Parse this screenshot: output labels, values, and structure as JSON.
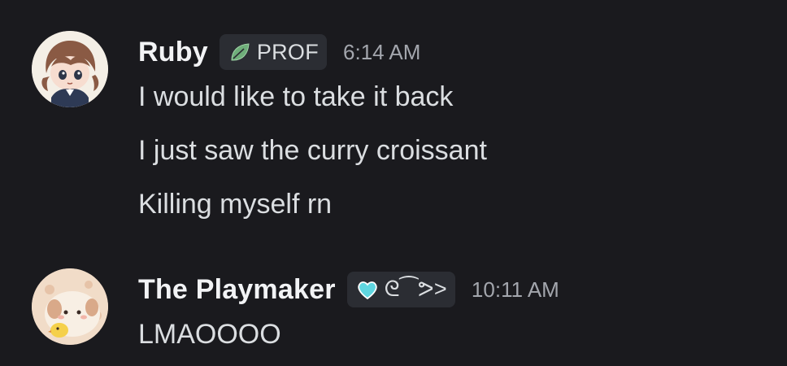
{
  "messages": [
    {
      "username": "Ruby",
      "tag": {
        "icon": "leaf-icon",
        "text": "PROF",
        "color": "#6fae7a"
      },
      "timestamp": "6:14 AM",
      "lines": [
        "I would like to take it back",
        "I just saw the curry croissant",
        "Killing myself rn"
      ]
    },
    {
      "username": "The Playmaker",
      "tag": {
        "icon": "heart-icon",
        "text": "ᘓ⁀ᕗ>",
        "color": "#5fd6e0"
      },
      "timestamp": "10:11 AM",
      "lines": [
        "LMAOOOO"
      ]
    }
  ],
  "colors": {
    "background": "#1a1a1e",
    "username": "#f2f3f5",
    "message_text": "#dbdee1",
    "timestamp": "#a3a6ad",
    "badge_background": "#2b2d33"
  }
}
